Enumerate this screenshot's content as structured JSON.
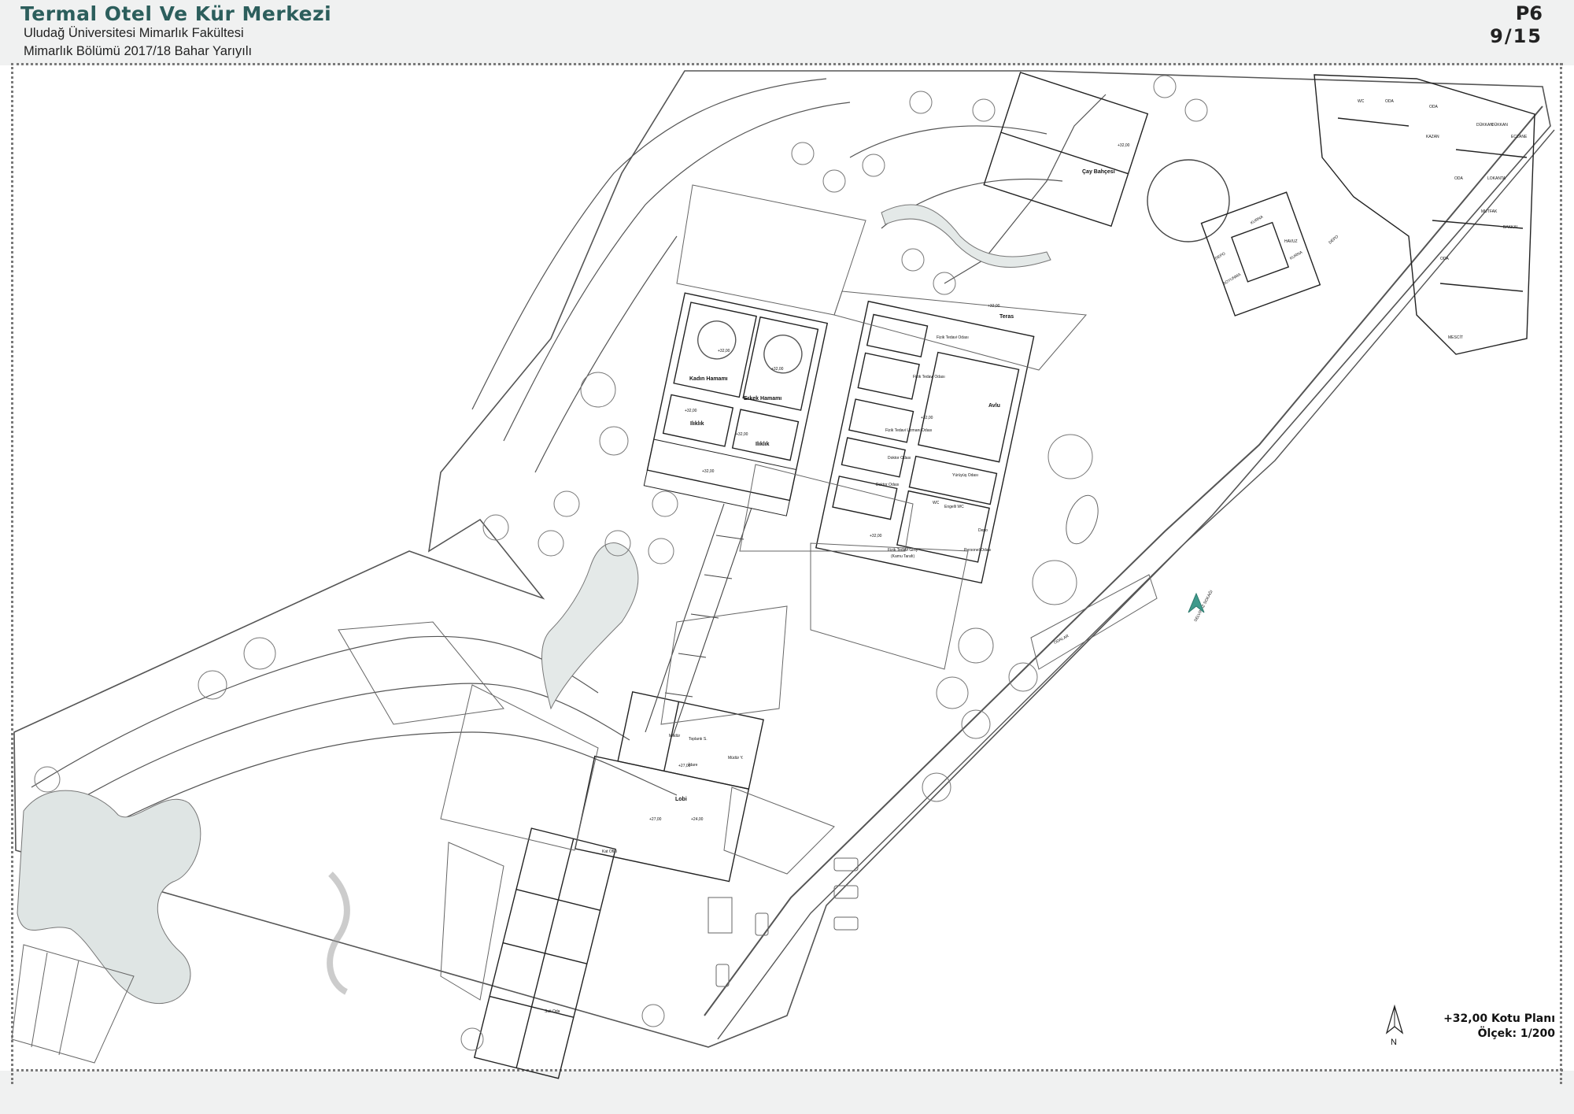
{
  "header": {
    "title": "Termal Otel Ve Kür Merkezi",
    "subtitle_1": "Uludağ Üniversitesi Mimarlık Fakültesi",
    "subtitle_2": "Mimarlık Bölümü 2017/18 Bahar Yarıyılı",
    "sheet_code": "P6",
    "sheet_number": "9/15"
  },
  "plan": {
    "name": "+32,00 Kotu Planı",
    "scale": "Ölçek: 1/200",
    "north": "N",
    "street": "SELVİNAZ SOKAĞI",
    "colors": {
      "accent": "#2c5e5c",
      "water": "#dfe5e4",
      "north_arrow": "#3f9a8c",
      "line": "#444444"
    },
    "rooms": {
      "teras": "Teras",
      "avlu": "Avlu",
      "kadin_hamami": "Kadın Hamamı",
      "erkek_hamami": "Erkek Hamamı",
      "iliklik_1": "Ilıklık",
      "iliklik_2": "Ilıklık",
      "fizik_1": "Fizik Tedavi Odası",
      "fizik_2": "Fizik Tedavi Odası",
      "fizik_uzman": "Fizik Tedavi Uzmanı Odası",
      "doktor_1": "Doktor Odası",
      "doktor_2": "Doktor Odası",
      "yuruyus": "Yürüyüş Odası",
      "engelli_wc": "Engelli WC",
      "wc": "WC",
      "depo": "Depo",
      "personel": "Personel Odası",
      "fizik_giris": "Fizik Tedavi Giriş",
      "kamu": "(Kamu Tarafı)",
      "cay": "Çay Bahçesi",
      "mudur": "Müdür",
      "toplanti": "Toplantı S.",
      "mudur_y": "Müdür Y.",
      "idare": "İdare",
      "lobi": "Lobi",
      "kat_ofisi": "Kat Ofisi",
      "suit": "Suit Oda",
      "odalar": "ODALAR",
      "havuz": "HAVUZ",
      "kurna_1": "KURNA",
      "kurna_2": "KURNA",
      "soyunma": "SOYUNMA",
      "depo_2": "DEPO",
      "depo_3": "DEPO",
      "oda_1": "ODA",
      "oda_2": "ODA",
      "oda_3": "ODA",
      "oda_4": "ODA",
      "dukkan_1": "DÜKKAN",
      "dukkan_2": "DÜKKAN",
      "eczane": "ECZANE",
      "lokanta": "LOKANTA",
      "mutfak": "MUTFAK",
      "bakkal": "BAKKAL",
      "kazan": "KAZAN",
      "wc_2": "WC",
      "mescit": "MESCİT"
    },
    "levels": {
      "l1": "+32,00",
      "l2": "+32,00",
      "l3": "+32,00",
      "l4": "+32,00",
      "l5": "+32,00",
      "l6": "+32,00",
      "l7": "+32,00",
      "l8": "+32,00",
      "l9": "+27,00",
      "l10": "+24,00",
      "l11": "+27,00",
      "l12": "+32,00"
    }
  }
}
